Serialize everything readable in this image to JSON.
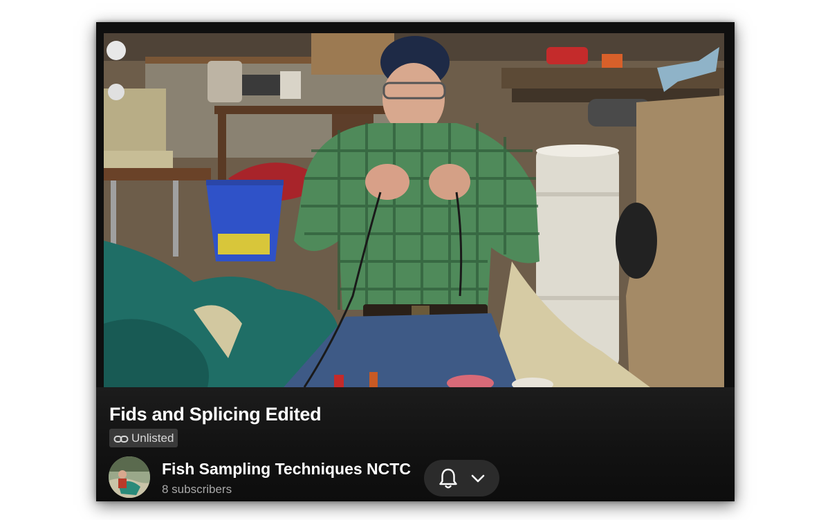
{
  "video": {
    "title": "Fids and Splicing Edited",
    "visibility_label": "Unlisted",
    "visibility_icon": "link-icon",
    "thumbnail_description_icon": "video-frame"
  },
  "channel": {
    "name": "Fish Sampling Techniques NCTC",
    "subscribers": "8 subscribers",
    "avatar_icon": "channel-avatar"
  },
  "subscribe": {
    "bell_icon": "bell-icon",
    "dropdown_icon": "chevron-down-icon"
  },
  "colors": {
    "background": "#0f0f0f",
    "text_primary": "#ffffff",
    "text_secondary": "#a8a8a8",
    "badge_bg": "#3a3a3a",
    "button_bg": "#2b2b2b"
  }
}
